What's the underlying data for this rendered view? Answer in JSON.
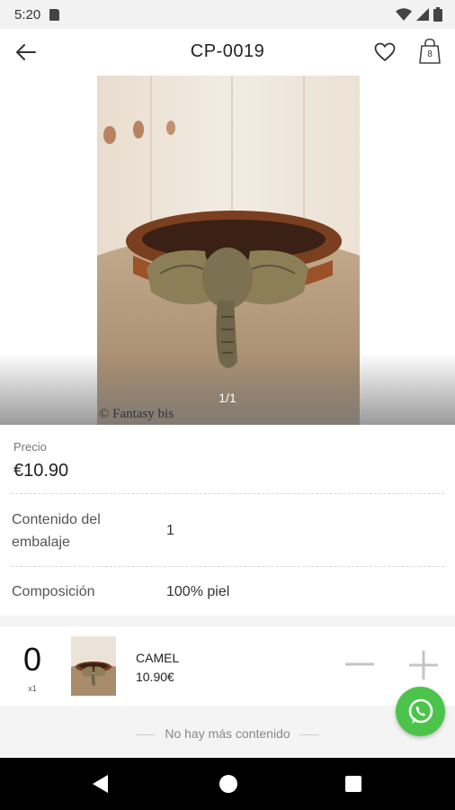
{
  "status_bar": {
    "time": "5:20"
  },
  "header": {
    "title": "CP-0019",
    "cart_count": "8"
  },
  "product_image": {
    "counter": "1/1",
    "watermark": "© Fantasy bis"
  },
  "details": {
    "price_label": "Precio",
    "price_value": "€10.90",
    "rows": [
      {
        "label": "Contenido del embalaje",
        "value": "1"
      },
      {
        "label": "Composición",
        "value": "100% piel"
      }
    ]
  },
  "variant": {
    "quantity": "0",
    "unit": "x1",
    "color": "CAMEL",
    "price": "10.90€"
  },
  "footer": {
    "no_more_text": "No hay más contenido"
  },
  "colors": {
    "accent_whatsapp": "#4cc44c",
    "nav_bar": "#000000",
    "status_bar": "#f2f2f2"
  }
}
